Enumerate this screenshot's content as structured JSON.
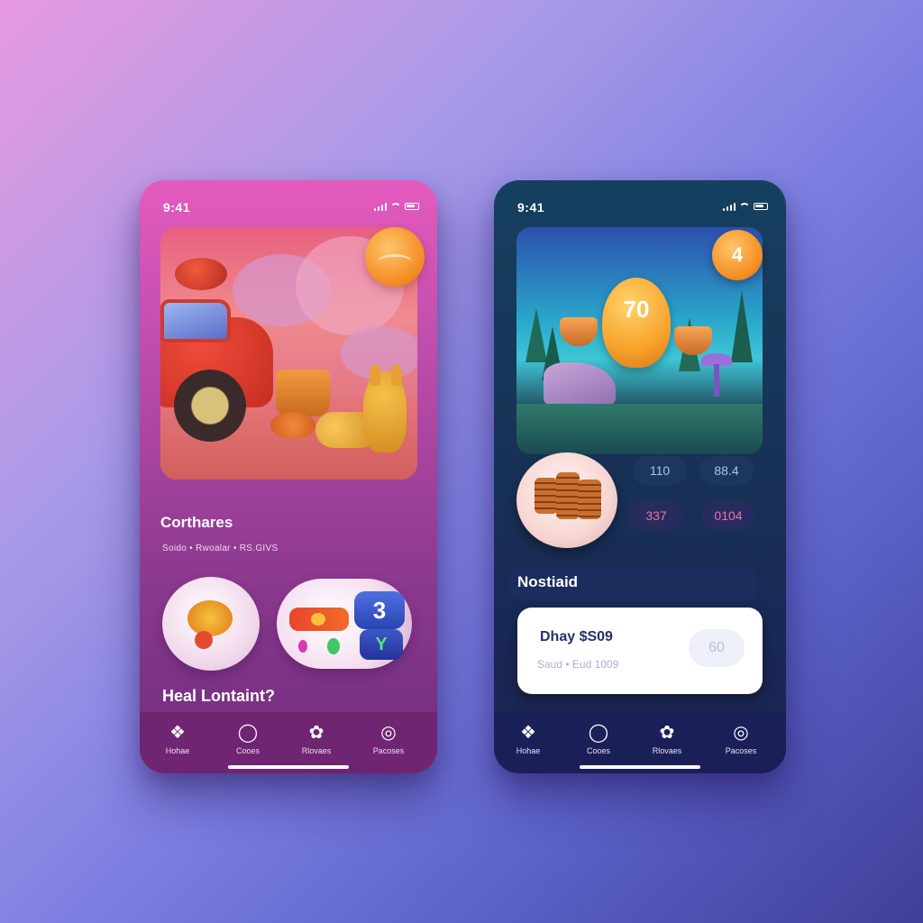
{
  "left_phone": {
    "status_time": "9:41",
    "badge_label": "",
    "section_title": "Corthares",
    "section_sub": "Soido • Rwoalar • RS.GIVS",
    "mini_num": "3",
    "mini_letter": "Y",
    "footer_title": "Heal Lontaint?",
    "nav": [
      {
        "icon": "home",
        "label": "Hohae"
      },
      {
        "icon": "game",
        "label": "Cooes"
      },
      {
        "icon": "paw",
        "label": "Rlovaes"
      },
      {
        "icon": "profile",
        "label": "Pacoses"
      }
    ]
  },
  "right_phone": {
    "status_time": "9:41",
    "hero_coin_num": "70",
    "hero_badge": "4",
    "stats": [
      "110",
      "88.4",
      "337",
      "0104"
    ],
    "section_title": "Nostiaid",
    "card": {
      "title": "Dhay $S09",
      "sub": "Saud • Eud 1009",
      "pill": "60"
    },
    "nav": [
      {
        "icon": "home",
        "label": "Hohae"
      },
      {
        "icon": "game",
        "label": "Cooes"
      },
      {
        "icon": "paw",
        "label": "Rlovaes"
      },
      {
        "icon": "profile",
        "label": "Pacoses"
      }
    ]
  },
  "colors": {
    "accent_orange": "#f28a1f",
    "left_bg": "#b64aa6",
    "right_bg": "#173457",
    "stat_pink": "#f071a8"
  }
}
